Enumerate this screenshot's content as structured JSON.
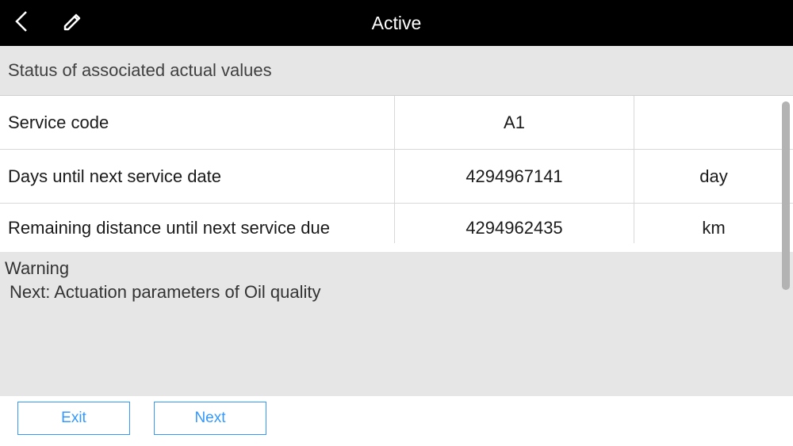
{
  "header": {
    "title": "Active"
  },
  "section": {
    "heading": "Status of associated actual values"
  },
  "rows": [
    {
      "label": "Service code",
      "value": "A1",
      "unit": ""
    },
    {
      "label": "Days until next service date",
      "value": "4294967141",
      "unit": "day"
    },
    {
      "label": "Remaining distance until next service due",
      "value": "4294962435",
      "unit": "km"
    }
  ],
  "status": {
    "line1": "Warning",
    "line2": "Next: Actuation parameters of Oil quality"
  },
  "footer": {
    "exit": "Exit",
    "next": "Next"
  }
}
